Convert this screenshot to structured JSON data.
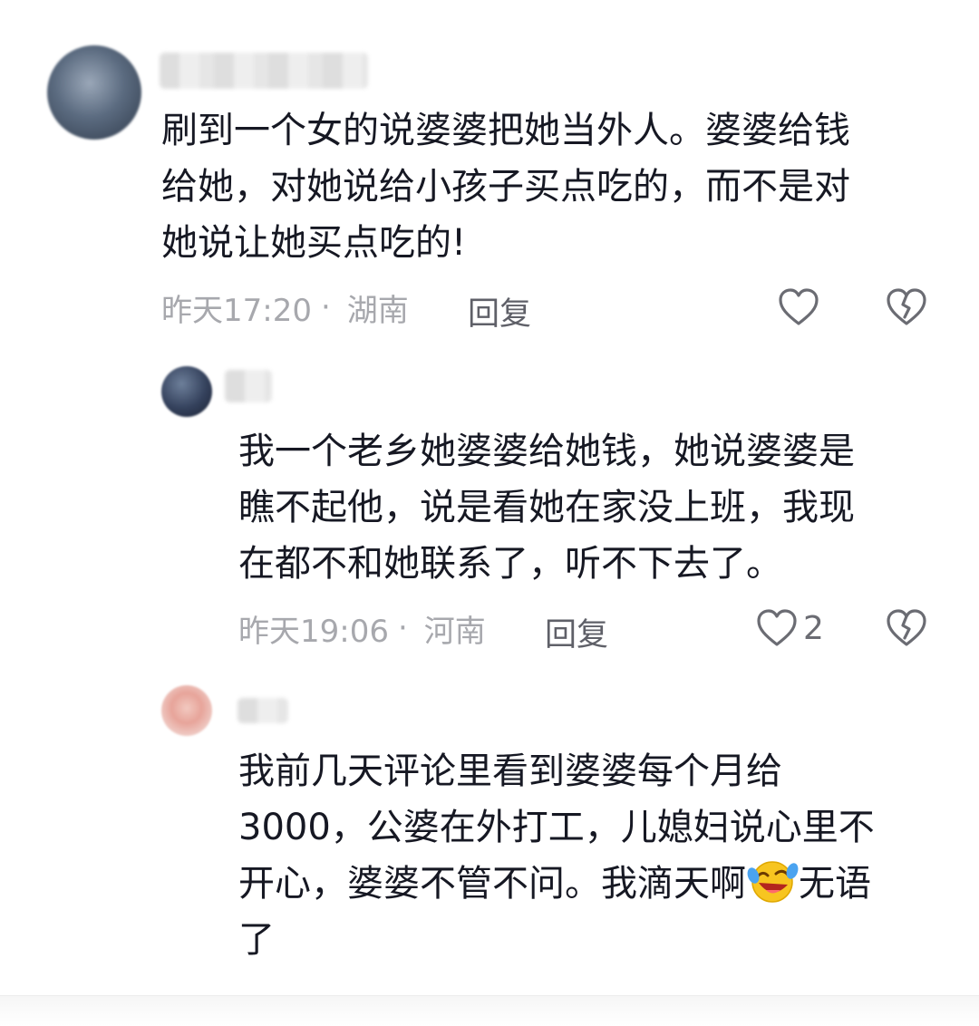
{
  "comments": {
    "main": {
      "text_lines": [
        "刷到一个女的说婆婆把她当外人。婆婆给钱",
        "给她，对她说给小孩子买点吃的，而不是对",
        "她说让她买点吃的!"
      ],
      "time": "昨天17:20",
      "separator": "·",
      "location": "湖南",
      "reply_label": "回复"
    },
    "reply1": {
      "text_lines": [
        "我一个老乡她婆婆给她钱，她说婆婆是",
        "瞧不起他，说是看她在家没上班，我现",
        "在都不和她联系了，听不下去了。"
      ],
      "time": "昨天19:06",
      "separator": "·",
      "location": "河南",
      "reply_label": "回复",
      "like_count": "2"
    },
    "reply2": {
      "text_lines": [
        "我前几天评论里看到婆婆每个月给",
        "3000，公婆在外打工，儿媳妇说心里不"
      ],
      "line3_before_emoji": "开心，婆婆不管不问。我滴天啊",
      "line3_after_emoji": "无语",
      "line4": "了"
    }
  },
  "icons": {
    "like": "heart-outline-icon",
    "dislike": "broken-heart-icon",
    "emoji": "rolling-laughing-emoji"
  },
  "colors": {
    "text": "#161823",
    "meta": "#a7a8ad",
    "reply": "#5f6068",
    "icon": "#6b6c73"
  }
}
